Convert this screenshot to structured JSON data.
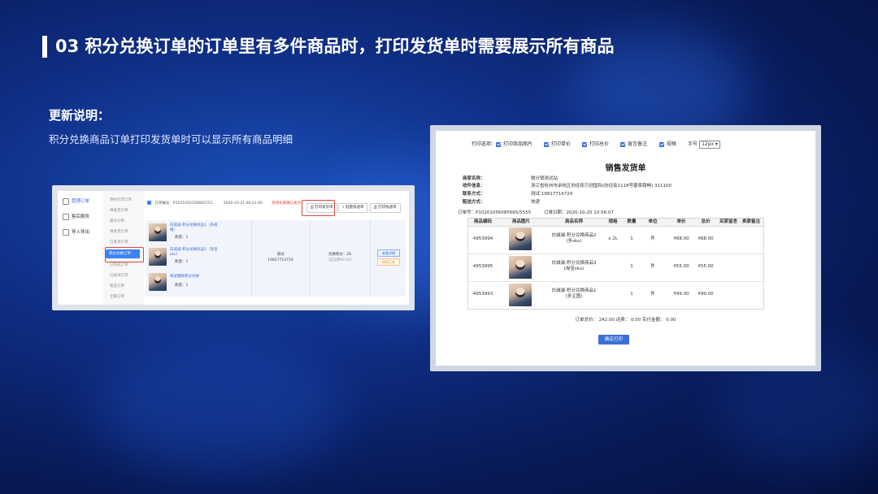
{
  "slide": {
    "title": "03 积分兑换订单的订单里有多件商品时，打印发货单时需要展示所有商品",
    "update_heading": "更新说明：",
    "update_text": "积分兑换商品订单打印发货单时可以显示所有商品明细"
  },
  "left_screenshot": {
    "sidebar": [
      {
        "label": "管理订单"
      },
      {
        "label": "售后服务"
      },
      {
        "label": "导入导出"
      }
    ],
    "subnav": [
      "预约打印订单",
      "待发货订单",
      "部分订单",
      "待发货订单",
      "已发货订单",
      "积分兑换订单",
      "已完成订单",
      "已关闭订单",
      "售后订单",
      "全部订单"
    ],
    "active_subnav_index": 5,
    "header": {
      "order_no": "订单编号：P1021050156665751",
      "time": "2020-10-21 09:21:00",
      "status": "等待买家确认发货"
    },
    "buttons": [
      "打印发货单",
      "批量快递单",
      "打印快递单"
    ],
    "products": [
      {
        "name": "白減減-积分兑换商品1（多规",
        "name2": "格）",
        "qty": "数量：1"
      },
      {
        "name": "白減減-积分兑换商品2（淘宝",
        "name2": "sku）",
        "qty": "数量：1"
      },
      {
        "name": "奇迹爆款积分兑换",
        "name2": "",
        "qty": "数量：1"
      }
    ],
    "receiver": {
      "name": "测试",
      "phone": "19817714724"
    },
    "payment": {
      "line1": "兑换积分：26",
      "line2": "（含运费¥0.00）"
    },
    "side_buttons": [
      "查看详情",
      "修改订单"
    ]
  },
  "right_screenshot": {
    "options_label": "打印选项：",
    "options": [
      "打印商品图片",
      "打印单价",
      "打印总价",
      "留言备注",
      "规格"
    ],
    "font_label": "字号",
    "font_value": "12px",
    "doc_title": "销售发货单",
    "info": [
      {
        "label": "商家名称：",
        "value": "微分销测试站"
      },
      {
        "label": "收件信息：",
        "value": "浙江省杭州市余杭区向往街万创国际(向往街1118号蒙泉路畅) 311100"
      },
      {
        "label": "联系方式：",
        "value": "测试 19817714724"
      },
      {
        "label": "配送方式：",
        "value": "快递"
      }
    ],
    "order_no": "订单号：P10201056085665/5555",
    "order_date": "订单日期：2020-10-20 10:56:07",
    "columns": [
      "商品编码",
      "商品图片",
      "商品名称",
      "规格",
      "数量",
      "单位",
      "单价",
      "总价",
      "买家留言",
      "卖家备注"
    ],
    "rows": [
      {
        "code": "4953994",
        "name1": "白減減-积分兑换商品2",
        "name2": "(多sku)",
        "spec": "x 2L",
        "qty": "1",
        "unit": "件",
        "price": "¥88.00",
        "total": "¥88.00"
      },
      {
        "code": "4953995",
        "name1": "白減減-积分兑换商品3",
        "name2": "(淘宝sku)",
        "spec": "",
        "qty": "1",
        "unit": "件",
        "price": "¥55.00",
        "total": "¥55.00"
      },
      {
        "code": "4953993",
        "name1": "白減減-积分兑换商品1",
        "name2": "(多主图)",
        "spec": "",
        "qty": "1",
        "unit": "件",
        "price": "¥99.00",
        "total": "¥99.00"
      }
    ],
    "totals": "订单总价：  242.00    运费：  0.00    实付金额：  0.00",
    "confirm_button": "确定打印"
  }
}
